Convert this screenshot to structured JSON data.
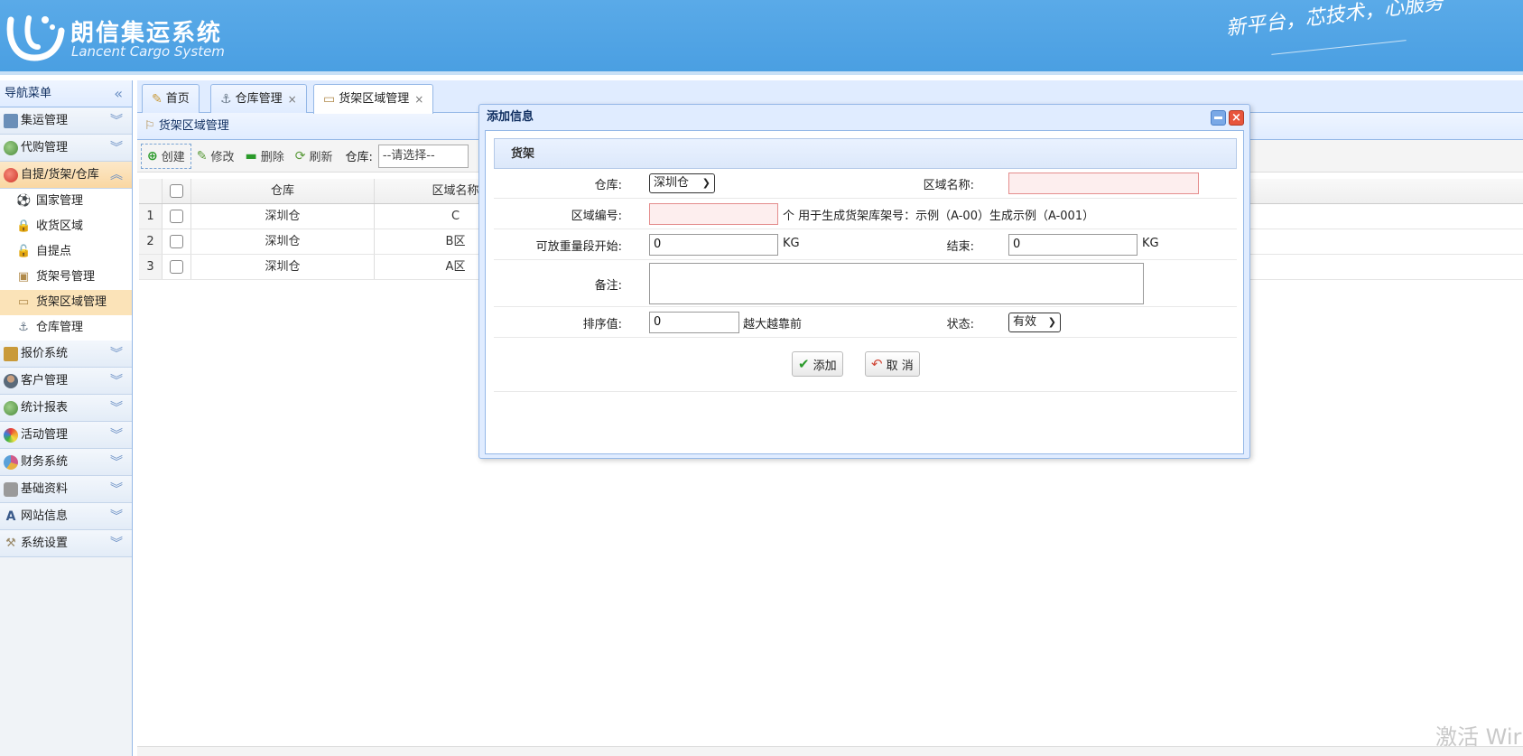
{
  "header": {
    "brand_cn": "朗信集运系统",
    "brand_en": "Lancent Cargo System",
    "slogan": "新平台，芯技术，心服务"
  },
  "sidebar": {
    "title": "导航菜单",
    "groups": [
      {
        "label": "集运管理",
        "icon": "monitor-icon",
        "color": "#6a8fb8"
      },
      {
        "label": "代购管理",
        "icon": "globe-icon",
        "color": "#5a9a4a"
      },
      {
        "label": "自提/货架/仓库",
        "icon": "red-circle-icon",
        "color": "#e0473a"
      },
      {
        "label": "报价系统",
        "icon": "coins-icon",
        "color": "#c99a3a"
      },
      {
        "label": "客户管理",
        "icon": "user-icon",
        "color": "#6a7a8a"
      },
      {
        "label": "统计报表",
        "icon": "globe-icon",
        "color": "#5a9a4a"
      },
      {
        "label": "活动管理",
        "icon": "rainbow-icon",
        "color": "#e8a040"
      },
      {
        "label": "财务系统",
        "icon": "chart-pie-icon",
        "color": "#d05a8a"
      },
      {
        "label": "基础资料",
        "icon": "database-icon",
        "color": "#8a8a8a"
      },
      {
        "label": "网站信息",
        "icon": "font-icon",
        "color": "#3a5a8a"
      },
      {
        "label": "系统设置",
        "icon": "wrench-icon",
        "color": "#9a8a6a"
      }
    ],
    "sub_items": [
      {
        "label": "国家管理",
        "icon": "soccer-ball-icon",
        "glyph": "⚽"
      },
      {
        "label": "收货区域",
        "icon": "lock-icon",
        "glyph": "🔒"
      },
      {
        "label": "自提点",
        "icon": "unlock-icon",
        "glyph": "🔓"
      },
      {
        "label": "货架号管理",
        "icon": "box-icon",
        "glyph": "▣"
      },
      {
        "label": "货架区域管理",
        "icon": "tray-icon",
        "glyph": "▭"
      },
      {
        "label": "仓库管理",
        "icon": "anchor-icon",
        "glyph": "⚓"
      }
    ]
  },
  "tabs": [
    {
      "label": "首页",
      "glyph": "✎"
    },
    {
      "label": "仓库管理",
      "glyph": "⚓",
      "close": "×"
    },
    {
      "label": "货架区域管理",
      "glyph": "▭",
      "close": "×"
    }
  ],
  "panel": {
    "title": "货架区域管理",
    "toolbar": {
      "create": "创建",
      "edit": "修改",
      "delete": "删除",
      "refresh": "刷新",
      "warehouse_label": "仓库:",
      "warehouse_placeholder": "--请选择--"
    },
    "grid": {
      "columns": [
        "仓库",
        "区域名称"
      ],
      "rows": [
        {
          "num": "1",
          "warehouse": "深圳仓",
          "area": "C"
        },
        {
          "num": "2",
          "warehouse": "深圳仓",
          "area": "B区"
        },
        {
          "num": "3",
          "warehouse": "深圳仓",
          "area": "A区"
        }
      ]
    }
  },
  "dialog": {
    "title": "添加信息",
    "section": "货架",
    "warehouse_label": "仓库:",
    "warehouse_value": "深圳仓",
    "area_name_label": "区域名称:",
    "area_name_value": "",
    "area_code_label": "区域编号:",
    "area_code_value": "",
    "area_code_hint": "个 用于生成货架库架号：示例（A-00）生成示例（A-001）",
    "weight_start_label": "可放重量段开始:",
    "weight_start_value": "0",
    "weight_unit": "KG",
    "weight_end_label": "结束:",
    "weight_end_value": "0",
    "remark_label": "备注:",
    "sort_label": "排序值:",
    "sort_value": "0",
    "sort_hint": "越大越靠前",
    "status_label": "状态:",
    "status_value": "有效",
    "add_button": "添加",
    "cancel_button": "取 消"
  },
  "watermark": "激活 Wir"
}
